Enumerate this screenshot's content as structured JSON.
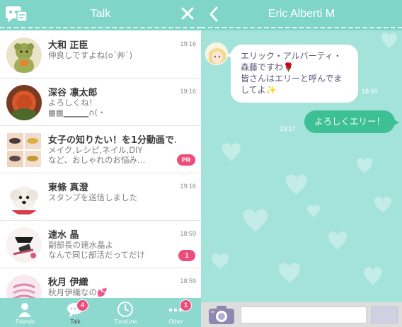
{
  "colors": {
    "header": "#7fd6c8",
    "chat_bg": "#a3e3da",
    "badge": "#ec4d7a",
    "outgoing_bubble": "#3cc094"
  },
  "left": {
    "title": "Talk",
    "logo_icon": "app-logo-icon",
    "close_icon": "close-icon",
    "chats": [
      {
        "name": "大和 正臣",
        "message": "仲良しですよね(o´艸`)",
        "time": "19:16",
        "badge": ""
      },
      {
        "name": "深谷 凛太郎",
        "message": "よろしくね！\n▦▦▁▁▁▁∩(・",
        "time": "19:16",
        "badge": ""
      },
      {
        "name": "女子の知りたい！を1分動画で…",
        "message": "メイク,レシピ,ネイル,DIY\nなど、おしゃれのお悩み…",
        "time": "",
        "badge": "PR"
      },
      {
        "name": "東條 真澄",
        "message": "スタンプを送信しました",
        "time": "19:16",
        "badge": ""
      },
      {
        "name": "速水 晶",
        "message": "副部長の速水晶よ\nなんで同じ部活だってだけ",
        "time": "18:59",
        "badge": "1"
      },
      {
        "name": "秋月 伊織",
        "message": "秋月伊織なの💕",
        "time": "18:59",
        "badge": ""
      }
    ],
    "tabs": [
      {
        "label": "Friends",
        "icon": "person-icon",
        "badge": ""
      },
      {
        "label": "Talk",
        "icon": "speech-bubble-icon",
        "badge": "4"
      },
      {
        "label": "TimeLine",
        "icon": "clock-icon",
        "badge": ""
      },
      {
        "label": "Other",
        "icon": "more-dots-icon",
        "badge": "1"
      }
    ]
  },
  "right": {
    "title": "Eric Alberti M",
    "back_icon": "back-chevron-icon",
    "messages": [
      {
        "from": "peer",
        "text": "エリック・アルバーティ・森藤ですわ🌹\n皆さんはエリーと呼んでましてよ✨",
        "time": "18:59"
      },
      {
        "from": "me",
        "text": "よろしくエリー！",
        "time": "19:17"
      }
    ],
    "input": {
      "value": "",
      "placeholder": ""
    },
    "camera_icon": "camera-icon"
  }
}
